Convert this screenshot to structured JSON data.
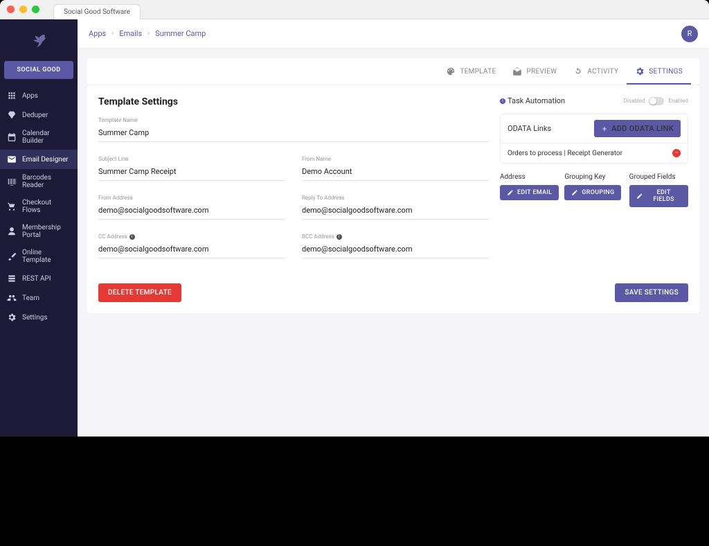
{
  "window": {
    "tab_title": "Social Good Software"
  },
  "sidebar": {
    "org_button": "SOCIAL GOOD",
    "items": [
      {
        "label": "Apps",
        "icon": "apps-icon"
      },
      {
        "label": "Deduper",
        "icon": "deduper-icon"
      },
      {
        "label": "Calendar Builder",
        "icon": "calendar-icon"
      },
      {
        "label": "Email Designer",
        "icon": "email-icon",
        "active": true
      },
      {
        "label": "Barcodes Reader",
        "icon": "barcode-icon"
      },
      {
        "label": "Checkout Flows",
        "icon": "cart-icon"
      },
      {
        "label": "Membership Portal",
        "icon": "user-icon"
      },
      {
        "label": "Online Template",
        "icon": "brush-icon"
      },
      {
        "label": "REST API",
        "icon": "api-icon"
      },
      {
        "label": "Team",
        "icon": "team-icon"
      },
      {
        "label": "Settings",
        "icon": "settings-icon"
      }
    ]
  },
  "breadcrumbs": [
    "Apps",
    "Emails",
    "Summer Camp"
  ],
  "avatar_initial": "R",
  "tabs": [
    {
      "label": "TEMPLATE",
      "icon": "palette-icon"
    },
    {
      "label": "PREVIEW",
      "icon": "mail-open-icon"
    },
    {
      "label": "ACTIVITY",
      "icon": "refresh-icon"
    },
    {
      "label": "SETTINGS",
      "icon": "gear-icon",
      "active": true
    }
  ],
  "settings": {
    "title": "Template Settings",
    "template_name": {
      "label": "Template Name",
      "value": "Summer Camp"
    },
    "subject_line": {
      "label": "Subject Line",
      "value": "Summer Camp Receipt"
    },
    "from_name": {
      "label": "From Name",
      "value": "Demo Account"
    },
    "from_address": {
      "label": "From Address",
      "value": "demo@socialgoodsoftware.com"
    },
    "reply_to": {
      "label": "Reply To Address",
      "value": "demo@socialgoodsoftware.com"
    },
    "cc": {
      "label": "CC Address",
      "value": "demo@socialgoodsoftware.com"
    },
    "bcc": {
      "label": "BCC Address",
      "value": "demo@socialgoodsoftware.com"
    }
  },
  "right": {
    "task_automation": {
      "label": "Task Automation",
      "disabled": "Disabled",
      "enabled": "Enabled"
    },
    "odata": {
      "title": "ODATA Links",
      "add_button": "ADD ODATA LINK",
      "rows": [
        "Orders to process | Receipt Generator"
      ]
    },
    "columns": {
      "address": {
        "label": "Address",
        "button": "EDIT EMAIL"
      },
      "grouping": {
        "label": "Grouping Key",
        "button": "GROUPING"
      },
      "fields": {
        "label": "Grouped Fields",
        "button": "EDIT FIELDS"
      }
    }
  },
  "buttons": {
    "delete": "DELETE TEMPLATE",
    "save": "SAVE SETTINGS"
  }
}
